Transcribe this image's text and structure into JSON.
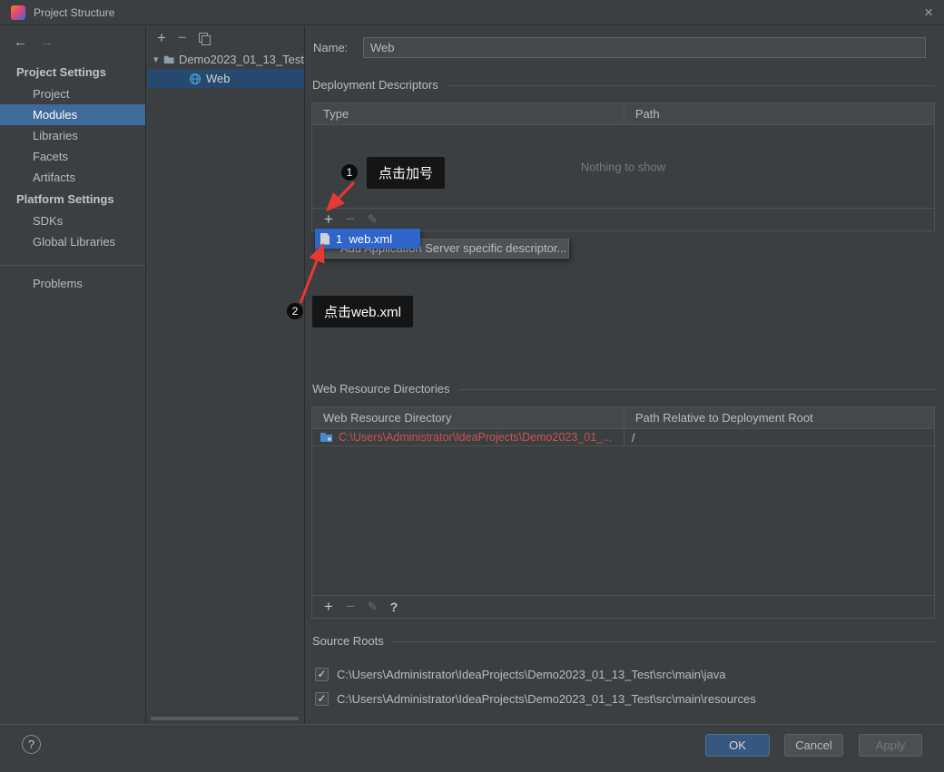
{
  "titlebar": {
    "title": "Project Structure"
  },
  "icons": {
    "close": "×",
    "back": "←",
    "forward": "→",
    "add": "+",
    "remove": "−",
    "edit": "✎",
    "help": "?",
    "chevron_down": "▾",
    "check": "✓"
  },
  "sidebar": {
    "project_settings_header": "Project Settings",
    "project_settings_items": [
      "Project",
      "Modules",
      "Libraries",
      "Facets",
      "Artifacts"
    ],
    "selected_item": "Modules",
    "platform_settings_header": "Platform Settings",
    "platform_settings_items": [
      "SDKs",
      "Global Libraries"
    ],
    "problems_item": "Problems"
  },
  "module_tree": {
    "root": "Demo2023_01_13_Test",
    "selected_child": "Web"
  },
  "form": {
    "name_label": "Name:",
    "name_value": "Web"
  },
  "deployment_descriptors": {
    "title": "Deployment Descriptors",
    "columns": [
      "Type",
      "Path"
    ],
    "empty_text": "Nothing to show"
  },
  "descriptor_popup": {
    "web_xml_item": "1  web.xml",
    "add_descriptor_item": "Add Application Server specific descriptor..."
  },
  "annotations": [
    {
      "badge": "1",
      "text": "点击加号"
    },
    {
      "badge": "2",
      "text": "点击web.xml"
    }
  ],
  "web_resource_directories": {
    "title": "Web Resource Directories",
    "columns": [
      "Web Resource Directory",
      "Path Relative to Deployment Root"
    ],
    "rows": [
      {
        "directory": "C:\\Users\\Administrator\\IdeaProjects\\Demo2023_01_...",
        "path": "/"
      }
    ]
  },
  "source_roots": {
    "title": "Source Roots",
    "items": [
      {
        "path": "C:\\Users\\Administrator\\IdeaProjects\\Demo2023_01_13_Test\\src\\main\\java",
        "checked": true
      },
      {
        "path": "C:\\Users\\Administrator\\IdeaProjects\\Demo2023_01_13_Test\\src\\main\\resources",
        "checked": true
      }
    ]
  },
  "footer": {
    "ok_label": "OK",
    "cancel_label": "Cancel",
    "apply_label": "Apply"
  },
  "colors": {
    "selection_blue": "#3f6a9c",
    "tree_selection": "#27496d",
    "popup_selection": "#2f65ca",
    "arrow_red": "#e53935",
    "path_text_red": "#c75450",
    "ok_button": "#365880"
  }
}
